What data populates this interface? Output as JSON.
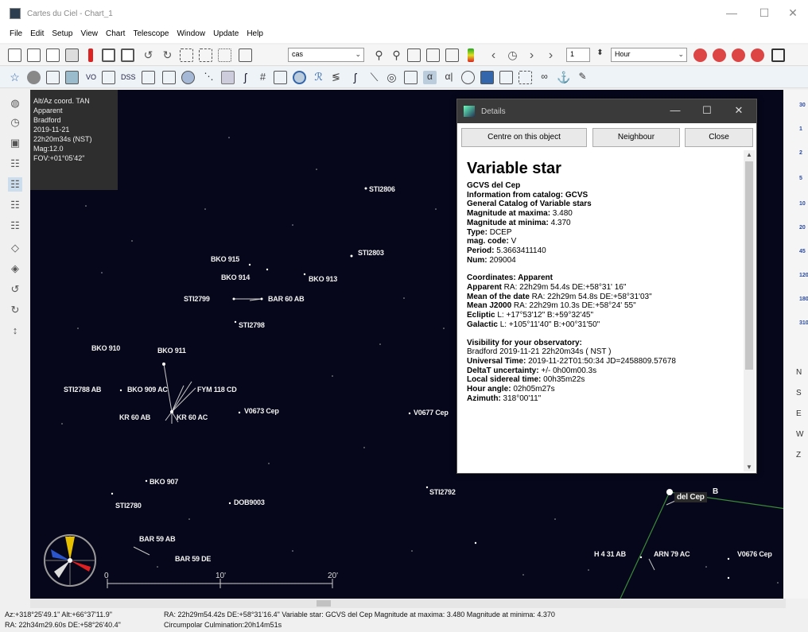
{
  "window": {
    "title": "Cartes du Ciel - Chart_1",
    "minimize": "—",
    "maximize": "☐",
    "close": "✕"
  },
  "menu": [
    "File",
    "Edit",
    "Setup",
    "View",
    "Chart",
    "Telescope",
    "Window",
    "Update",
    "Help"
  ],
  "toolbar": {
    "projection_combo": "cas",
    "step_value": "1",
    "step_unit": "Hour",
    "tb2_labels": [
      "VO",
      "DSS"
    ]
  },
  "chart_info": {
    "lines": [
      "Alt/Az coord. TAN",
      "Apparent",
      "Bradford",
      "2019-11-21",
      "22h20m34s (NST)",
      "Mag:12.0",
      "FOV:+01°05'42\""
    ]
  },
  "star_labels": [
    "STI2806",
    "STI2803",
    "BKO 915",
    "BKO 914",
    "BKO 913",
    "STI2799",
    "BAR 60 AB",
    "STI2798",
    "BKO 910",
    "BKO 911",
    "STI2788 AB",
    "BKO 909 AC",
    "FYM 118 CD",
    "KR 60 AB",
    "KR 60 AC",
    "V0673 Cep",
    "V0677 Cep",
    "BKO 907",
    "STI2780",
    "DOB9003",
    "STI2792",
    "BAR 59 AB",
    "BAR 59 DE",
    "H 4 31 AB",
    "ARN 79 AC",
    "V0676 Cep",
    "del Cep",
    "B"
  ],
  "scale": {
    "labels": [
      "0",
      "10'",
      "20'"
    ]
  },
  "right_strip": {
    "labels": [
      "30",
      "1",
      "2",
      "5",
      "10",
      "20",
      "45",
      "120",
      "180",
      "310"
    ],
    "buttons": [
      "N",
      "S",
      "E",
      "W",
      "Z"
    ]
  },
  "details": {
    "title": "Details",
    "buttons": {
      "centre": "Centre on this object",
      "neighbour": "Neighbour",
      "close": "Close"
    },
    "heading": "Variable star",
    "lines": [
      {
        "label": "GCVS del Cep",
        "value": ""
      },
      {
        "label": "Information from catalog: GCVS",
        "value": ""
      },
      {
        "label": "General Catalog of Variable stars",
        "value": ""
      },
      {
        "label": "Magnitude at maxima:",
        "value": " 3.480"
      },
      {
        "label": "Magnitude at minima:",
        "value": " 4.370"
      },
      {
        "label": "Type:",
        "value": " DCEP"
      },
      {
        "label": "mag. code:",
        "value": " V"
      },
      {
        "label": "Period:",
        "value": " 5.3663411140"
      },
      {
        "label": "Num:",
        "value": " 209004"
      },
      {
        "label": "",
        "value": ""
      },
      {
        "label": "Coordinates: Apparent",
        "value": ""
      },
      {
        "label": "Apparent",
        "value": " RA: 22h29m 54.4s DE:+58°31' 16\""
      },
      {
        "label": "Mean of the date",
        "value": " RA: 22h29m 54.8s DE:+58°31'03\""
      },
      {
        "label": "Mean J2000",
        "value": " RA: 22h29m 10.3s DE:+58°24' 55\""
      },
      {
        "label": "Ecliptic",
        "value": " L: +17°53'12\" B:+59°32'45\""
      },
      {
        "label": "Galactic",
        "value": " L: +105°11'40\" B:+00°31'50\""
      },
      {
        "label": "",
        "value": ""
      },
      {
        "label": "Visibility for your observatory:",
        "value": ""
      },
      {
        "label": "",
        "value": "Bradford 2019-11-21 22h20m34s ( NST )"
      },
      {
        "label": "Universal Time:",
        "value": " 2019-11-22T01:50:34 JD=2458809.57678"
      },
      {
        "label": "DeltaT uncertainty:",
        "value": " +/- 0h00m00.3s"
      },
      {
        "label": "Local sidereal time:",
        "value": " 00h35m22s"
      },
      {
        "label": "Hour angle:",
        "value": " 02h05m27s"
      },
      {
        "label": "Azimuth:",
        "value": " 318°00'11\""
      }
    ]
  },
  "status": {
    "azalt": "Az:+318°25'49.1\" Alt:+66°37'11.9\"",
    "radec": "RA: 22h34m29.60s DE:+58°26'40.4\"",
    "object": "RA: 22h29m54.42s DE:+58°31'16.4\"  Variable star: GCVS del Cep  Magnitude at maxima: 3.480  Magnitude at minima: 4.370",
    "extra": "Circumpolar   Culmination:20h14m51s"
  }
}
